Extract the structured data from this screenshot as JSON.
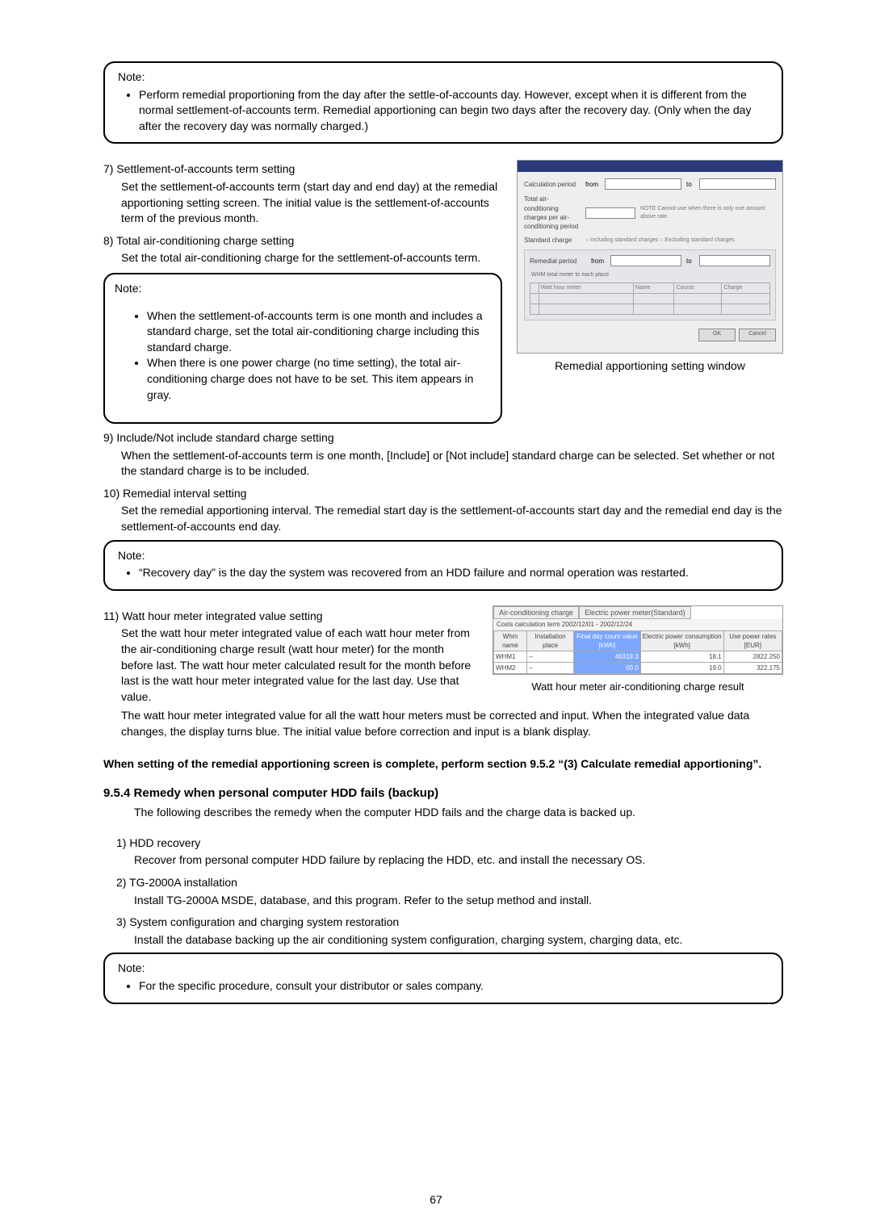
{
  "note1": {
    "title": "Note:",
    "b1": "Perform remedial proportioning from the day after the settle-of-accounts day. However, except when it is different from the normal settlement-of-accounts term. Remedial apportioning can begin two days after the recovery day. (Only when the day after the recovery day was normally charged.)"
  },
  "s7": {
    "num": "7)  Settlement-of-accounts term setting",
    "body": "Set the settlement-of-accounts term (start day and end day) at the remedial apportioning setting screen. The initial value is the settlement-of-accounts term of the previous month."
  },
  "s8": {
    "num": "8)  Total air-conditioning charge setting",
    "body": "Set the total air-conditioning charge for the settlement-of-accounts term."
  },
  "note2": {
    "title": "Note:",
    "b1": "When the settlement-of-accounts term is one month and includes a standard charge, set the total air-conditioning charge including this standard charge.",
    "b2": "When there is one power charge (no time setting), the total air-conditioning charge does not have to be set. This item appears in gray."
  },
  "fig1_caption": "Remedial apportioning setting window",
  "s9": {
    "num": "9)  Include/Not include standard charge setting",
    "body": "When the settlement-of-accounts term is one month, [Include] or [Not include] standard charge can be selected. Set whether or not the standard charge is to be included."
  },
  "s10": {
    "num": "10) Remedial interval setting",
    "body": "Set the remedial apportioning interval. The remedial start day is the settlement-of-accounts start day and the remedial end day is the settlement-of-accounts end day."
  },
  "note3": {
    "title": "Note:",
    "b1": "“Recovery day” is the day the system was recovered from an HDD failure and normal operation was restarted."
  },
  "s11": {
    "num": "11) Watt hour meter integrated value setting",
    "body1": "Set the watt hour meter integrated value of each watt hour meter from the air-conditioning charge result (watt hour meter) for the month before last. The watt hour meter calculated result for the month before last is the watt hour meter integrated value for the last day. Use that value.",
    "body2": "The watt hour meter integrated value for all the watt hour meters must be corrected and input. When the integrated value data changes, the display turns blue. The initial value before correction and input is a blank display."
  },
  "fig2": {
    "tab1": "Air-conditioning charge",
    "tab2": "Electric power meter(Standard)",
    "line": "Costs calculation term 2002/12/01 - 2002/12/24",
    "h1": "Whm name",
    "h2": "Installation place",
    "h3": "Final day count value [kWh]",
    "h4": "Electric power consumption [kWh]",
    "h5": "Use power rates [EUR]",
    "r1c1": "WHM1",
    "r1c2": "--",
    "r1c3": "46319.3",
    "r1c4": "18.1",
    "r1c5": "2822.250",
    "r2c1": "WHM2",
    "r2c2": "--",
    "r2c3": "00.0",
    "r2c4": "19.0",
    "r2c5": "322.175",
    "caption": "Watt hour meter air-conditioning charge result"
  },
  "after11": "When setting of the remedial apportioning screen is complete, perform section 9.5.2 “(3) Calculate remedial apportioning”.",
  "h954": "9.5.4 Remedy when personal computer HDD fails (backup)",
  "h954_intro": "The following describes the remedy when the computer HDD fails and the charge data is backed up.",
  "b1": {
    "num": "1)  HDD recovery",
    "body": "Recover from personal computer HDD failure by replacing the HDD, etc. and install the necessary OS."
  },
  "b2": {
    "num": "2)  TG-2000A installation",
    "body": "Install TG-2000A MSDE, database, and this program. Refer to the setup method and install."
  },
  "b3": {
    "num": "3)  System configuration and charging system restoration",
    "body": "Install the database backing up the air conditioning system configuration, charging system, charging data, etc."
  },
  "note4": {
    "title": "Note:",
    "b1": "For the specific procedure, consult your distributor or sales company."
  },
  "page": "67"
}
